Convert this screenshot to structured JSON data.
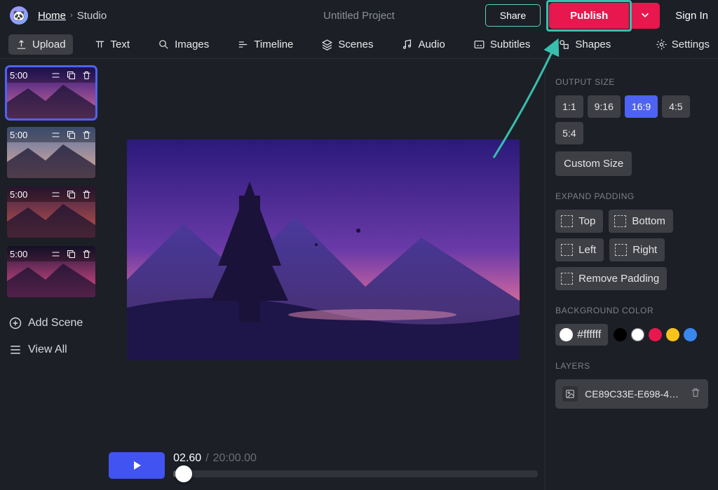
{
  "header": {
    "home": "Home",
    "location": "Studio",
    "project_title": "Untitled Project",
    "share": "Share",
    "publish": "Publish",
    "signin": "Sign In"
  },
  "toolbar": {
    "upload": "Upload",
    "text": "Text",
    "images": "Images",
    "timeline": "Timeline",
    "scenes": "Scenes",
    "audio": "Audio",
    "subtitles": "Subtitles",
    "shapes": "Shapes",
    "settings": "Settings"
  },
  "scenes": {
    "items": [
      {
        "duration": "5:00"
      },
      {
        "duration": "5:00"
      },
      {
        "duration": "5:00"
      },
      {
        "duration": "5:00"
      }
    ],
    "add_scene": "Add Scene",
    "view_all": "View All"
  },
  "player": {
    "current": "02.60",
    "total": "20:00.00"
  },
  "props": {
    "output_size": "OUTPUT SIZE",
    "ratios": [
      "1:1",
      "9:16",
      "16:9",
      "4:5",
      "5:4"
    ],
    "ratio_selected": 2,
    "custom_size": "Custom Size",
    "expand_padding": "EXPAND PADDING",
    "pad_top": "Top",
    "pad_bottom": "Bottom",
    "pad_left": "Left",
    "pad_right": "Right",
    "remove_padding": "Remove Padding",
    "background_color": "BACKGROUND COLOR",
    "bg_hex": "#ffffff",
    "swatches": [
      "#000000",
      "#ffffff",
      "#e8174e",
      "#f6c21b",
      "#3a87f2"
    ],
    "layers": "LAYERS",
    "layer_name": "CE89C33E-E698-4C2D-…"
  }
}
